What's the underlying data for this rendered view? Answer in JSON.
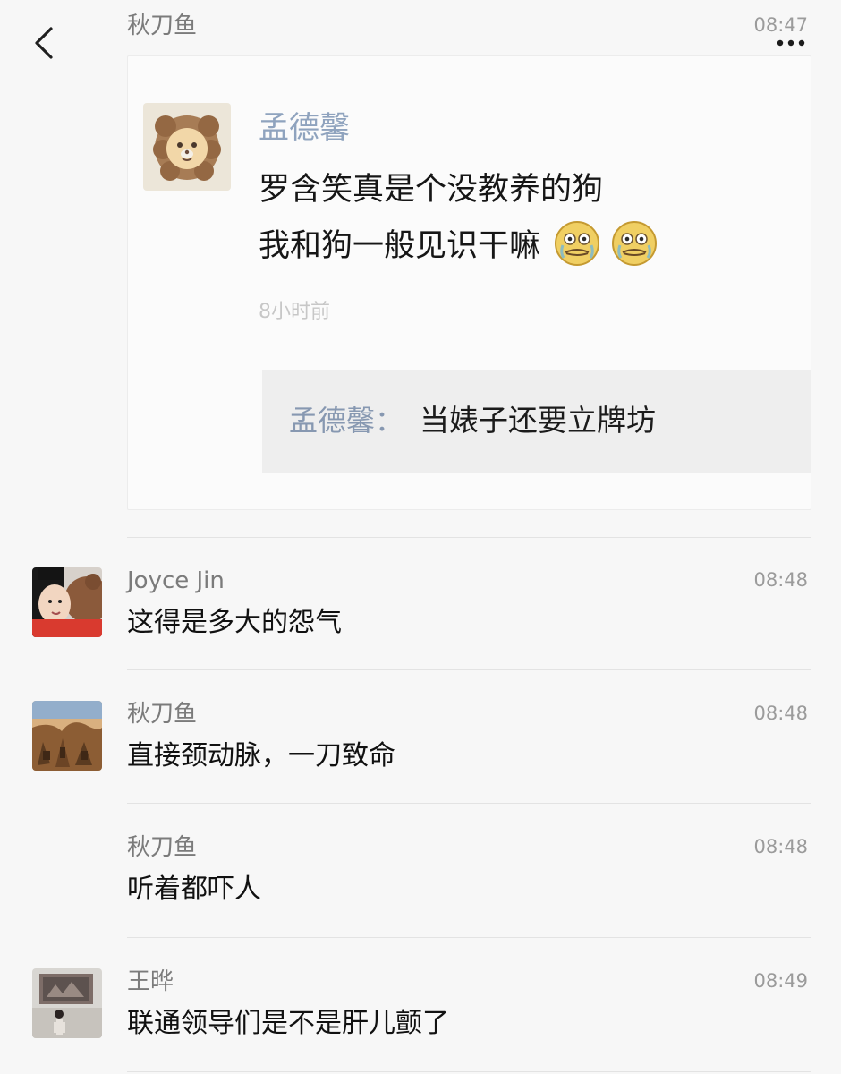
{
  "post": {
    "author": "秋刀鱼",
    "time": "08:47",
    "embedded": {
      "author": "孟德馨",
      "lines": [
        "罗含笑真是个没教养的狗",
        "我和狗一般见识干嘛"
      ],
      "relative_time": "8小时前",
      "reply": {
        "author": "孟德馨：",
        "text": "当婊子还要立牌坊"
      }
    }
  },
  "comments": [
    {
      "name": "Joyce Jin",
      "time": "08:48",
      "text": "这得是多大的怨气",
      "avatar": "avatar-joyce-jin"
    },
    {
      "name": "秋刀鱼",
      "time": "08:48",
      "text": "直接颈动脉，一刀致命",
      "avatar": "avatar-qiudaoyu"
    },
    {
      "name": "秋刀鱼",
      "time": "08:48",
      "text": "听着都吓人",
      "avatar": ""
    },
    {
      "name": "王晔",
      "time": "08:49",
      "text": "联通领导们是不是肝儿颤了",
      "avatar": "avatar-wang-ye"
    }
  ],
  "icons": {
    "back": "chevron-left-icon",
    "more": "more-icon",
    "embedded_avatar": "lion-avatar-icon",
    "emoji": "grimace-emoji"
  }
}
